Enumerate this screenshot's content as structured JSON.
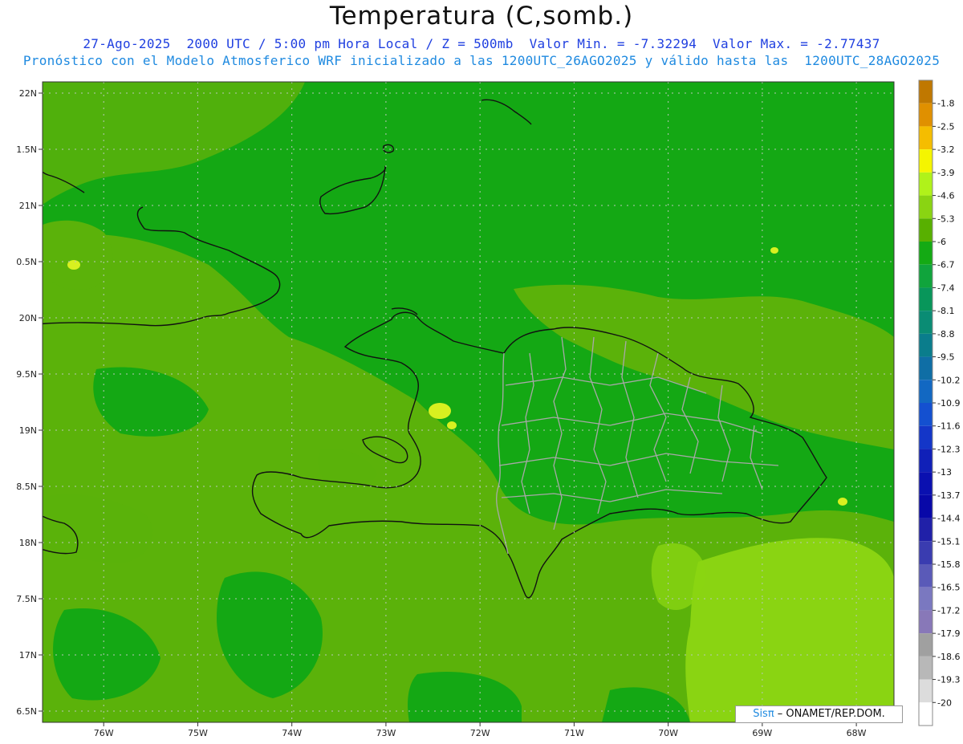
{
  "title": "Temperatura (C,somb.)",
  "subtitle_line1": "27-Ago-2025  2000 UTC / 5:00 pm Hora Local / Z = 500mb  Valor Min. = -7.32294  Valor Max. = -2.77437",
  "subtitle_line2": "Pronóstico con el Modelo Atmosferico WRF inicializado a las 1200UTC_26AGO2025 y válido hasta las  1200UTC_28AGO2025",
  "credit": {
    "brand": "Sisπ",
    "text": " – ONAMET/REP.DOM."
  },
  "axes": {
    "lon_labels": [
      "76W",
      "75W",
      "74W",
      "73W",
      "72W",
      "71W",
      "70W",
      "69W",
      "68W"
    ],
    "lat_labels": [
      "22N",
      "1.5N",
      "21N",
      "0.5N",
      "20N",
      "9.5N",
      "19N",
      "8.5N",
      "18N",
      "7.5N",
      "17N",
      "6.5N"
    ],
    "lon_range": [
      -76.65,
      -67.6
    ],
    "lat_range": [
      16.4,
      22.1
    ]
  },
  "colorbar": {
    "labels": [
      "-1.8",
      "-2.5",
      "-3.2",
      "-3.9",
      "-4.6",
      "-5.3",
      "-6",
      "-6.7",
      "-7.4",
      "-8.1",
      "-8.8",
      "-9.5",
      "-10.2",
      "-10.9",
      "-11.6",
      "-12.3",
      "-13",
      "-13.7",
      "-14.4",
      "-15.1",
      "-15.8",
      "-16.5",
      "-17.2",
      "-17.9",
      "-18.6",
      "-19.3",
      "-20"
    ],
    "colors": [
      "#c07800",
      "#e09000",
      "#f5bd00",
      "#f5f500",
      "#b0f21a",
      "#8ad412",
      "#58b000",
      "#14aa14",
      "#10a43c",
      "#08965a",
      "#0a8c74",
      "#0a7d8c",
      "#0f6ea5",
      "#1268c2",
      "#1450d0",
      "#1436c8",
      "#1020b8",
      "#0a10b0",
      "#0808a8",
      "#2020a8",
      "#3a3cb0",
      "#5a5ab8",
      "#7a78c0",
      "#8878b8",
      "#a0a0a0",
      "#b8b8b8",
      "#dcdcdc",
      "#ffffff"
    ]
  },
  "field": {
    "background": "#14a814",
    "lighter": "#5bb20a",
    "light": "#8ad412",
    "yellow": "#d8f020"
  }
}
